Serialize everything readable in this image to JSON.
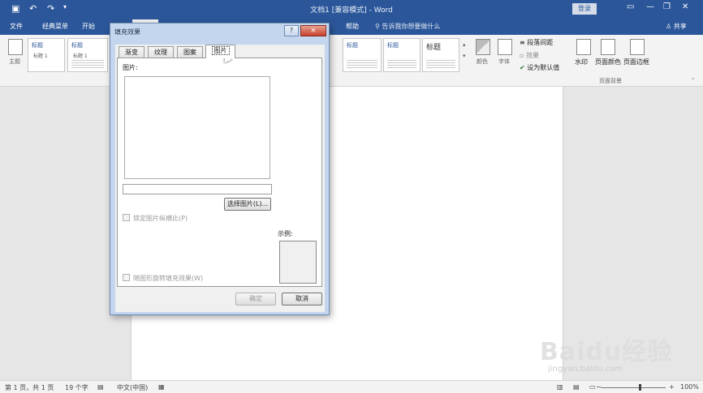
{
  "titlebar": {
    "title": "文档1 [兼容模式] - Word",
    "login": "登录"
  },
  "tabs": [
    {
      "label": "文件"
    },
    {
      "label": "经典菜单"
    },
    {
      "label": "开始"
    },
    {
      "label": "帮助"
    }
  ],
  "search_placeholder": "告诉我你想要做什么",
  "share_label": "共享",
  "ribbon": {
    "theme_label": "主题",
    "style_thumbs": [
      {
        "title": "标题",
        "sub": "标题 1"
      },
      {
        "title": "标题",
        "sub": "标题 1"
      },
      {
        "title": "标题",
        "sub": "标题 1"
      },
      {
        "title": "标题",
        "sub": ""
      },
      {
        "title": "标题",
        "sub": ""
      },
      {
        "title": "标题",
        "sub": ""
      }
    ],
    "colors_label": "颜色",
    "fonts_label": "字体",
    "para_spacing": "段落间距",
    "effects": "效果",
    "set_default": "设为默认值",
    "watermark": "水印",
    "page_color": "页面颜色",
    "page_border": "页面边框",
    "group_label": "页面背景"
  },
  "status": {
    "page": "第 1 页，共 1 页",
    "words": "19 个字",
    "lang": "中文(中国)",
    "zoom": "100%"
  },
  "dialog": {
    "title": "填充效果",
    "help": "?",
    "close": "×",
    "tabs": [
      "渐变",
      "纹理",
      "图案",
      "图片"
    ],
    "active_tab": 3,
    "picture_label": "图片:",
    "select_picture": "选择图片(L)...",
    "lock_ratio": "锁定图片纵横比(P)",
    "sample_label": "示例:",
    "rotate_with_shape": "随图形旋转填充效果(W)",
    "ok": "确定",
    "cancel": "取消"
  },
  "watermark": {
    "logo": "Baidu经验",
    "url": "jingyan.baidu.com"
  },
  "colors": {
    "title_bar": "#2b579a",
    "ribbon": "#f3f3f3",
    "dialog_frame": "#c4d6ee"
  }
}
